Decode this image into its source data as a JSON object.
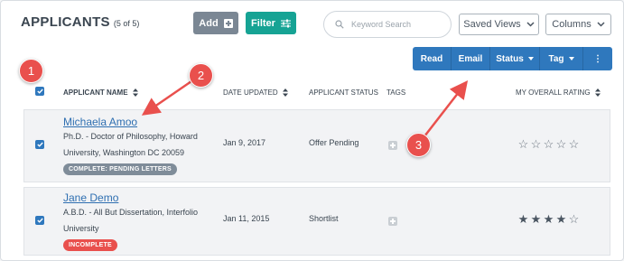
{
  "header": {
    "title": "APPLICANTS",
    "count": "(5 of 5)"
  },
  "toolbar": {
    "add_label": "Add",
    "filter_label": "Filter"
  },
  "search": {
    "placeholder": "Keyword Search"
  },
  "views": {
    "saved_views_label": "Saved Views",
    "columns_label": "Columns"
  },
  "actions": {
    "read": "Read",
    "email": "Email",
    "status": "Status",
    "tag": "Tag",
    "more": "⋮"
  },
  "columns": {
    "name": "APPLICANT NAME",
    "date": "DATE UPDATED",
    "status": "APPLICANT STATUS",
    "tags": "TAGS",
    "rating": "MY OVERALL RATING"
  },
  "rows": [
    {
      "name": "Michaela Amoo",
      "degree_line1": "Ph.D. - Doctor of Philosophy, Howard",
      "degree_line2": "University, Washington DC 20059",
      "badge": "COMPLETE: PENDING LETTERS",
      "date": "Jan 9, 2017",
      "status": "Offer Pending",
      "rating": 0
    },
    {
      "name": "Jane Demo",
      "degree_line1": "A.B.D. - All But Dissertation, Interfolio",
      "degree_line2": "University",
      "badge": "INCOMPLETE",
      "date": "Jan 11, 2015",
      "status": "Shortlist",
      "rating": 4
    }
  ],
  "callouts": [
    "1",
    "2",
    "3"
  ],
  "colors": {
    "primary": "#2f78bd",
    "teal": "#16a394",
    "gray_button": "#7b8794",
    "callout": "#e9504d",
    "link": "#2f6fb1"
  }
}
